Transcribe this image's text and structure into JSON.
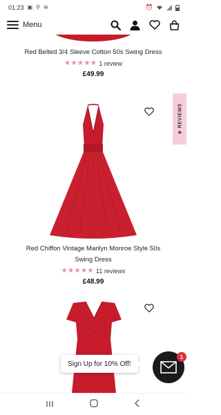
{
  "status_bar": {
    "time": "01:23",
    "left_icons": [
      "gallery-icon",
      "usb-icon",
      "dnd-icon"
    ],
    "right_icons": [
      "alarm-icon",
      "wifi-icon",
      "signal-icon",
      "battery-icon"
    ]
  },
  "header": {
    "menu_label": "Menu",
    "icons": [
      "search-icon",
      "user-icon",
      "heart-icon",
      "bag-icon"
    ]
  },
  "products": [
    {
      "name": "Red Belted 3/4 Sleeve Cotton 50s Swing Dress",
      "stars": "★★★★★",
      "reviews": "1 review",
      "price": "£49.99"
    },
    {
      "name": "Red Chiffon Vintage Marilyn Monroe Style 50s Swing Dress",
      "stars": "★★★★★",
      "reviews": "11 reviews",
      "price": "£48.99"
    }
  ],
  "reviews_tab": {
    "label": "★ REVIEWS"
  },
  "signup": {
    "label": "Sign Up for 10% Off!"
  },
  "mail_badge": {
    "count": "1"
  },
  "colors": {
    "dress_red": "#c61c2b",
    "star_pink": "#e889b0",
    "reviews_tab_bg": "#f7cddc"
  },
  "nav_bar": {
    "icons": [
      "recent-apps-icon",
      "home-icon",
      "back-icon"
    ]
  }
}
